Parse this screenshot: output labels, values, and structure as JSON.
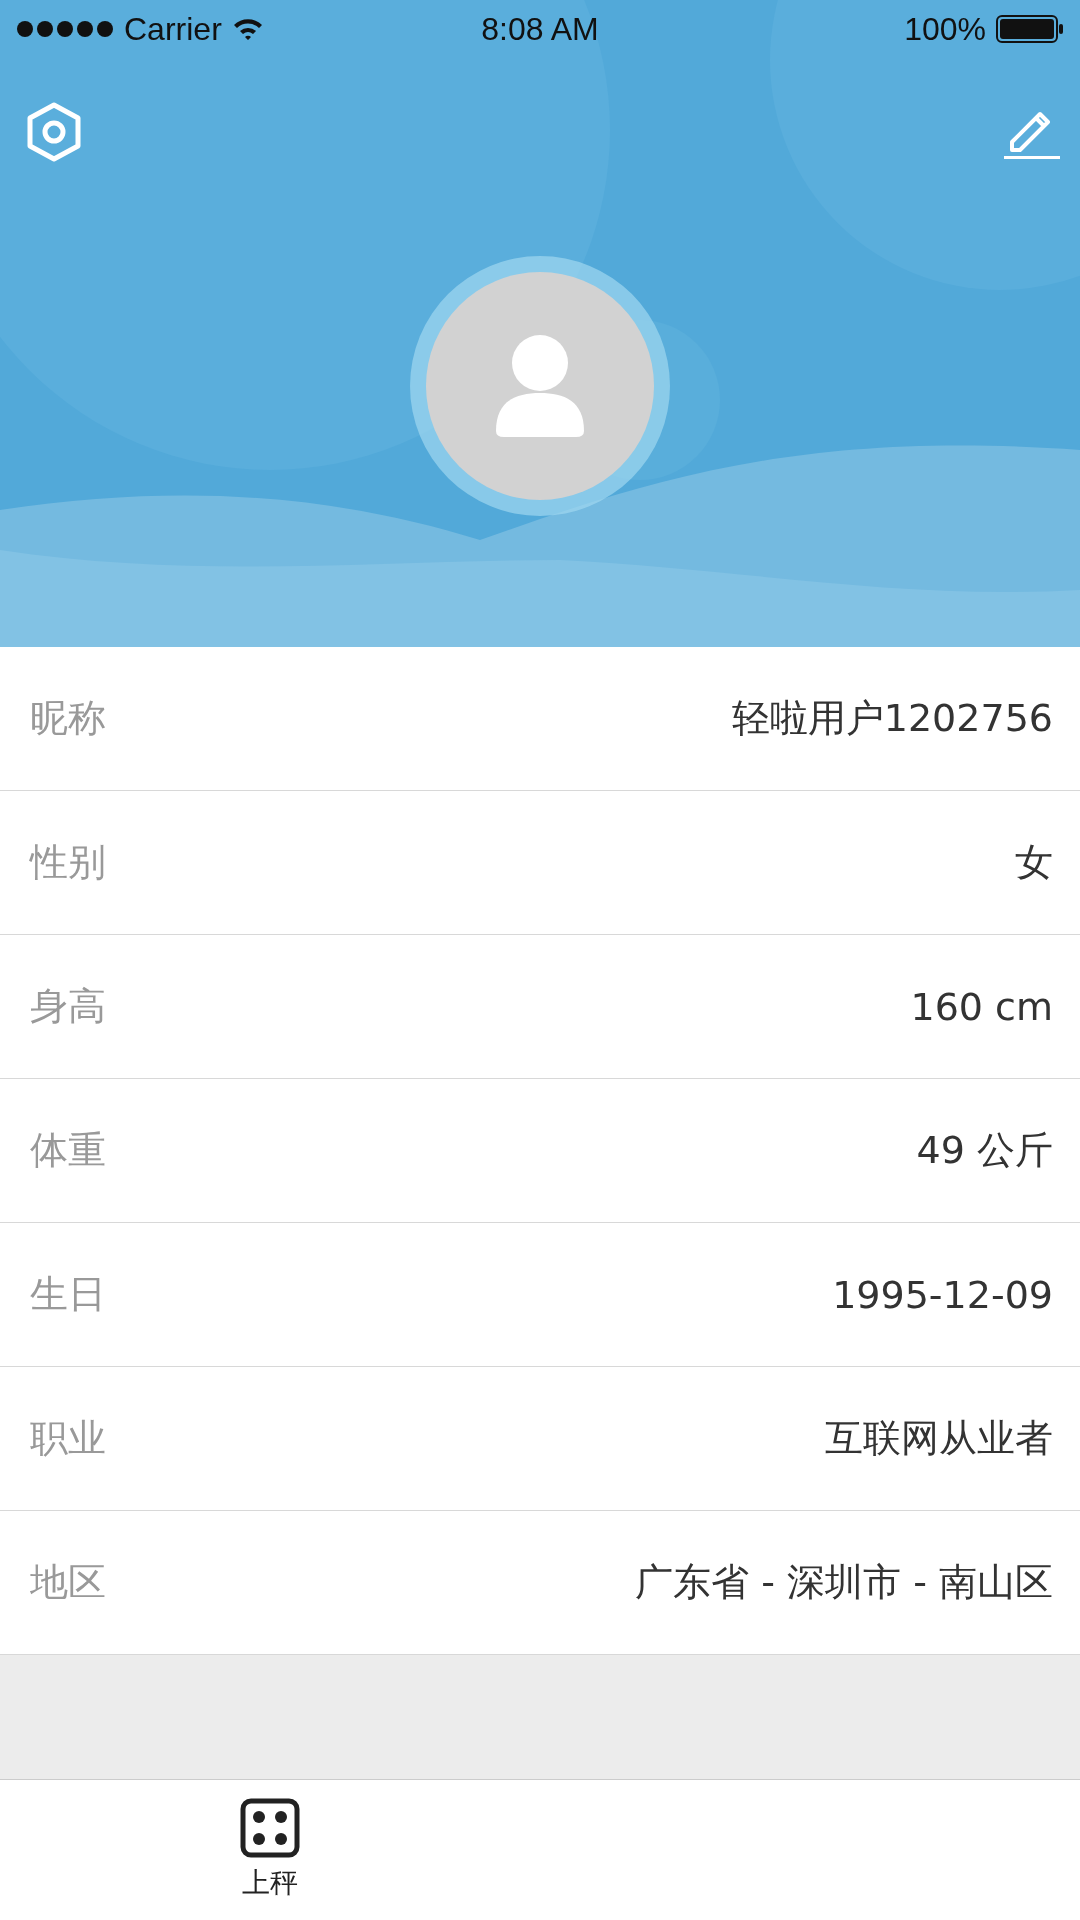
{
  "status_bar": {
    "carrier": "Carrier",
    "time": "8:08 AM",
    "battery": "100%"
  },
  "profile_rows": [
    {
      "label": "昵称",
      "value": "轻啦用户1202756"
    },
    {
      "label": "性别",
      "value": "女"
    },
    {
      "label": "身高",
      "value": "160 cm"
    },
    {
      "label": "体重",
      "value": "49 公斤"
    },
    {
      "label": "生日",
      "value": "1995-12-09"
    },
    {
      "label": "职业",
      "value": "互联网从业者"
    },
    {
      "label": "地区",
      "value": "广东省 - 深圳市 - 南山区"
    }
  ],
  "tab_bar": [
    {
      "label": "上秤",
      "selected": true
    }
  ]
}
